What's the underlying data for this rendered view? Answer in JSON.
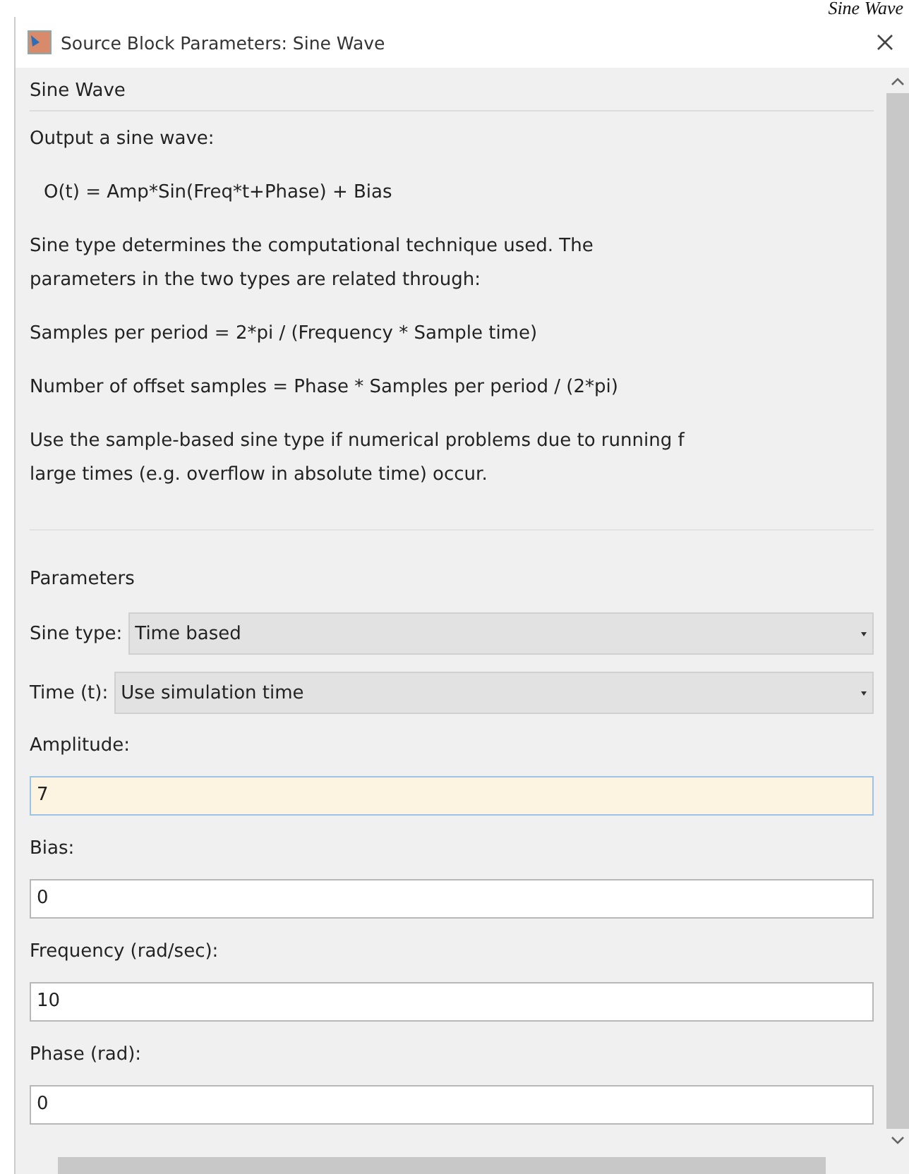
{
  "background_text": "Sine Wave",
  "window": {
    "title": "Source Block Parameters: Sine Wave"
  },
  "block_name": "Sine Wave",
  "description": [
    {
      "kind": "text",
      "text": "Output a sine wave:"
    },
    {
      "kind": "formula",
      "text": "O(t) = Amp*Sin(Freq*t+Phase) + Bias"
    },
    {
      "kind": "text",
      "lines": [
        "Sine type determines the computational technique used. The",
        "parameters in the two types are related through:"
      ]
    },
    {
      "kind": "text",
      "text": "Samples per period = 2*pi / (Frequency * Sample time)"
    },
    {
      "kind": "text",
      "text": "Number of offset samples = Phase * Samples per period / (2*pi)"
    },
    {
      "kind": "text",
      "lines": [
        "Use the sample-based sine type if numerical problems due to running f",
        "large times (e.g. overflow in absolute time) occur."
      ]
    }
  ],
  "parameters_heading": "Parameters",
  "parameters": [
    {
      "kind": "dropdown",
      "label": "Sine type:",
      "value": "Time based"
    },
    {
      "kind": "dropdown",
      "label": "Time (t):",
      "value": "Use simulation time"
    },
    {
      "kind": "field",
      "label": "Amplitude:",
      "value": "7",
      "focused": true
    },
    {
      "kind": "field",
      "label": "Bias:",
      "value": "0",
      "focused": false
    },
    {
      "kind": "field",
      "label": "Frequency (rad/sec):",
      "value": "10",
      "focused": false
    },
    {
      "kind": "field",
      "label": "Phase (rad):",
      "value": "0",
      "focused": false
    }
  ]
}
